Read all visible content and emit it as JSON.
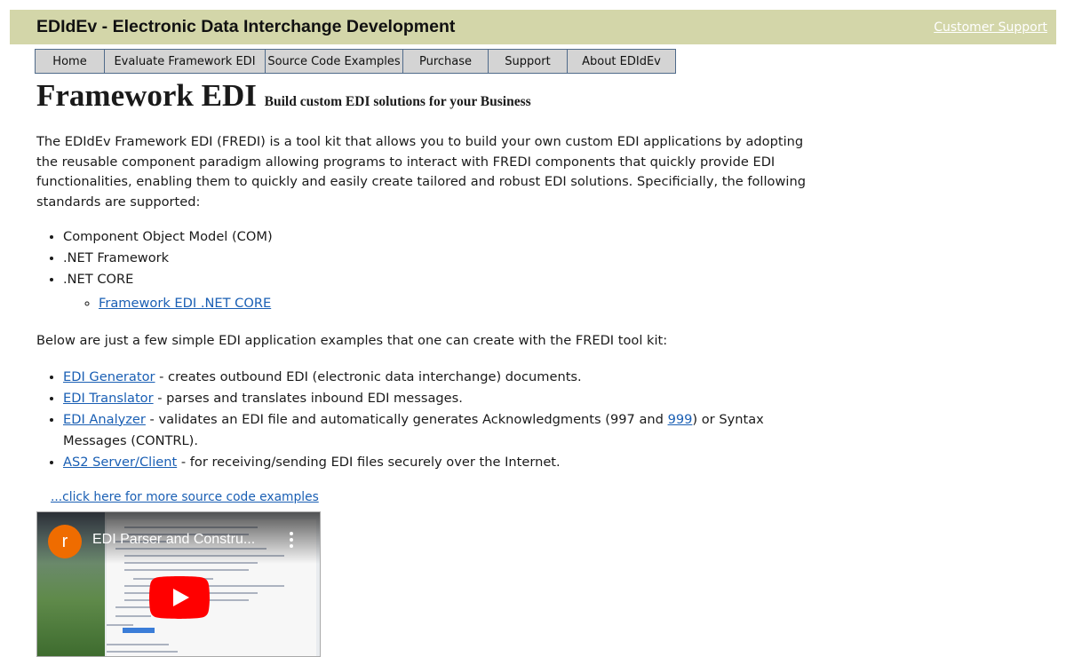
{
  "header": {
    "site_title": "EDIdEv - Electronic Data Interchange Development",
    "support_link": "Customer Support"
  },
  "nav": {
    "items": [
      {
        "label": "Home"
      },
      {
        "label": "Evaluate Framework EDI"
      },
      {
        "label": "Source Code Examples"
      },
      {
        "label": "Purchase"
      },
      {
        "label": "Support"
      },
      {
        "label": "About EDIdEv"
      }
    ]
  },
  "main": {
    "heading": "Framework EDI",
    "subtitle": "Build custom EDI solutions for your Business",
    "intro": "The EDIdEv Framework EDI (FREDI) is a tool kit that allows you to build your own custom EDI applications by adopting the reusable component paradigm allowing programs to interact with FREDI components that quickly provide EDI functionalities, enabling them to quickly and easily create tailored and robust EDI solutions. Specificially, the following standards are supported:",
    "standards": [
      "Component Object Model (COM)",
      ".NET Framework",
      ".NET CORE"
    ],
    "core_sublink": "Framework EDI .NET CORE",
    "examples_intro": "Below are just a few simple EDI application examples that one can create with the FREDI tool kit:",
    "examples": [
      {
        "link": "EDI Generator",
        "text": " - creates outbound EDI (electronic data interchange) documents."
      },
      {
        "link": "EDI Translator",
        "text": " - parses and translates inbound EDI messages."
      },
      {
        "link": "EDI Analyzer",
        "text": " - validates an EDI file and automatically generates Acknowledgments (997 and ",
        "link2": "999",
        "text2": ") or Syntax Messages (CONTRL)."
      },
      {
        "link": "AS2 Server/Client",
        "text": " - for receiving/sending EDI files securely over the Internet."
      }
    ],
    "more_link": "...click here for more source code examples"
  },
  "video": {
    "channel_initial": "r",
    "title": "EDI Parser and Constru...",
    "accent_color": "#ff0000"
  }
}
